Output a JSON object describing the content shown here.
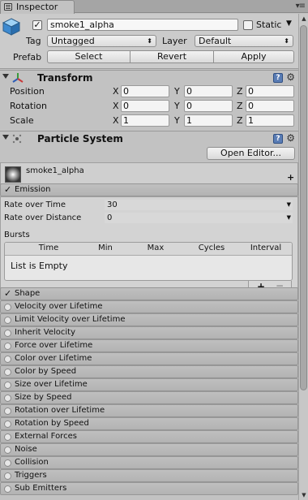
{
  "window": {
    "tab_label": "Inspector"
  },
  "gameobject": {
    "name": "smoke1_alpha",
    "active_checked": true,
    "static_label": "Static",
    "tag_label": "Tag",
    "tag_value": "Untagged",
    "layer_label": "Layer",
    "layer_value": "Default",
    "prefab_label": "Prefab",
    "prefab_buttons": [
      "Select",
      "Revert",
      "Apply"
    ]
  },
  "transform": {
    "title": "Transform",
    "rows": [
      {
        "label": "Position",
        "x": "0",
        "y": "0",
        "z": "0"
      },
      {
        "label": "Rotation",
        "x": "0",
        "y": "0",
        "z": "0"
      },
      {
        "label": "Scale",
        "x": "1",
        "y": "1",
        "z": "1"
      }
    ],
    "axes": [
      "X",
      "Y",
      "Z"
    ]
  },
  "particle_system": {
    "title": "Particle System",
    "open_editor_label": "Open Editor...",
    "main_module": "smoke1_alpha",
    "emission": {
      "label": "Emission",
      "rate_over_time_label": "Rate over Time",
      "rate_over_time_value": "30",
      "rate_over_distance_label": "Rate over Distance",
      "rate_over_distance_value": "0",
      "bursts_label": "Bursts",
      "bursts_columns": [
        "Time",
        "Min",
        "Max",
        "Cycles",
        "Interval"
      ],
      "bursts_empty": "List is Empty",
      "add_symbol": "+",
      "remove_symbol": "−"
    },
    "shape_label": "Shape",
    "modules": [
      "Velocity over Lifetime",
      "Limit Velocity over Lifetime",
      "Inherit Velocity",
      "Force over Lifetime",
      "Color over Lifetime",
      "Color by Speed",
      "Size over Lifetime",
      "Size by Speed",
      "Rotation over Lifetime",
      "Rotation by Speed",
      "External Forces",
      "Noise",
      "Collision",
      "Triggers",
      "Sub Emitters"
    ]
  }
}
